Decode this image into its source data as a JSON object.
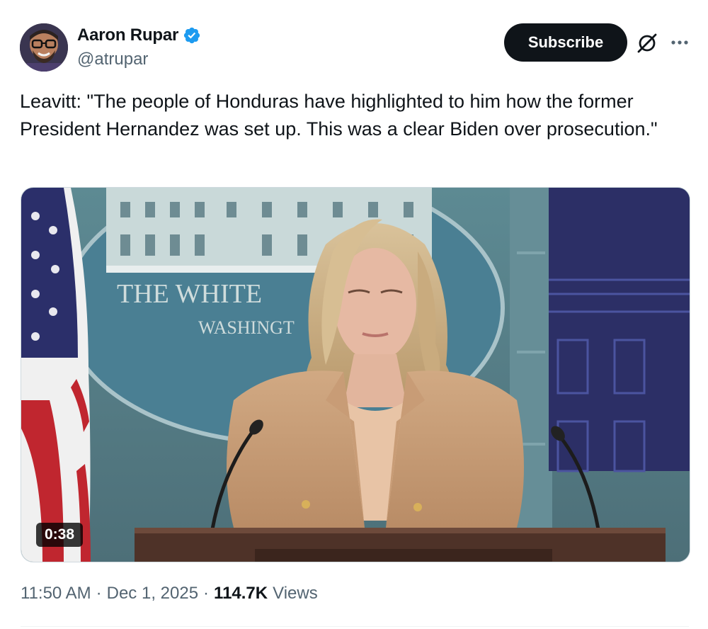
{
  "author": {
    "display_name": "Aaron Rupar",
    "handle": "@atrupar",
    "verified_icon": "verified-badge-icon",
    "verified_color": "#1d9bf0"
  },
  "actions": {
    "subscribe_label": "Subscribe",
    "grok_icon": "grok-icon",
    "more_icon": "more-options-icon"
  },
  "tweet": {
    "text": "Leavitt: \"The people of Honduras have highlighted to him how the former President Hernandez was set up. This was a clear Biden over prosecution.\""
  },
  "media": {
    "duration": "0:38",
    "backdrop_sign_line1": "THE WHITE",
    "backdrop_sign_line2": "WASHINGT"
  },
  "meta": {
    "time": "11:50 AM",
    "separator": "·",
    "date": "Dec 1, 2025",
    "views_count": "114.7K",
    "views_label": "Views"
  }
}
